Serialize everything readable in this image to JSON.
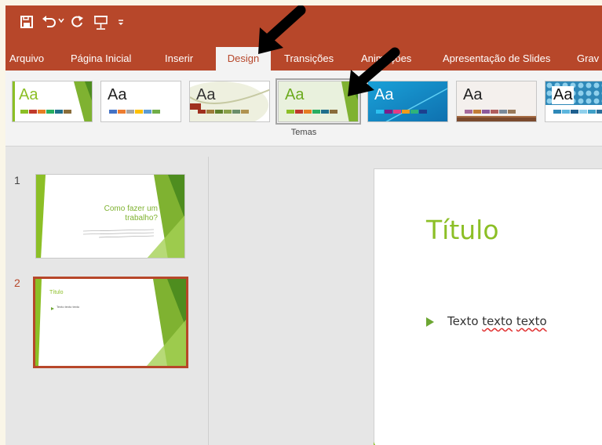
{
  "quick_access": {
    "icons": [
      "save-icon",
      "undo-icon",
      "undo-dropdown-icon",
      "redo-icon",
      "presentation-from-start-icon",
      "customize-qat-icon"
    ]
  },
  "tabs": [
    {
      "label": "Arquivo"
    },
    {
      "label": "Página Inicial"
    },
    {
      "label": "Inserir"
    },
    {
      "label": "Design",
      "active": true
    },
    {
      "label": "Transições"
    },
    {
      "label": "Animações"
    },
    {
      "label": "Apresentação de Slides"
    },
    {
      "label": "Grav"
    }
  ],
  "themes": {
    "label": "Temas",
    "items": [
      {
        "text": "Aa",
        "name": "theme-facet-green"
      },
      {
        "text": "Aa",
        "name": "theme-office"
      },
      {
        "text": "Aa",
        "name": "theme-wisp"
      },
      {
        "text": "Aa",
        "name": "theme-facet-selected",
        "selected": true
      },
      {
        "text": "Aa",
        "name": "theme-ion-blue"
      },
      {
        "text": "Aa",
        "name": "theme-wood"
      },
      {
        "text": "Aa",
        "name": "theme-pattern"
      }
    ]
  },
  "slides": [
    {
      "number": "1",
      "title": "Como fazer um trabalho?"
    },
    {
      "number": "2",
      "title": "Título",
      "bullet": "Texto texto texto",
      "selected": true
    }
  ],
  "current_slide": {
    "title": "Título",
    "bullet_first": "Texto",
    "bullet_second": "texto",
    "bullet_third": "texto"
  },
  "colors": {
    "accent": "#b7472a",
    "theme_green": "#8cbf26"
  }
}
